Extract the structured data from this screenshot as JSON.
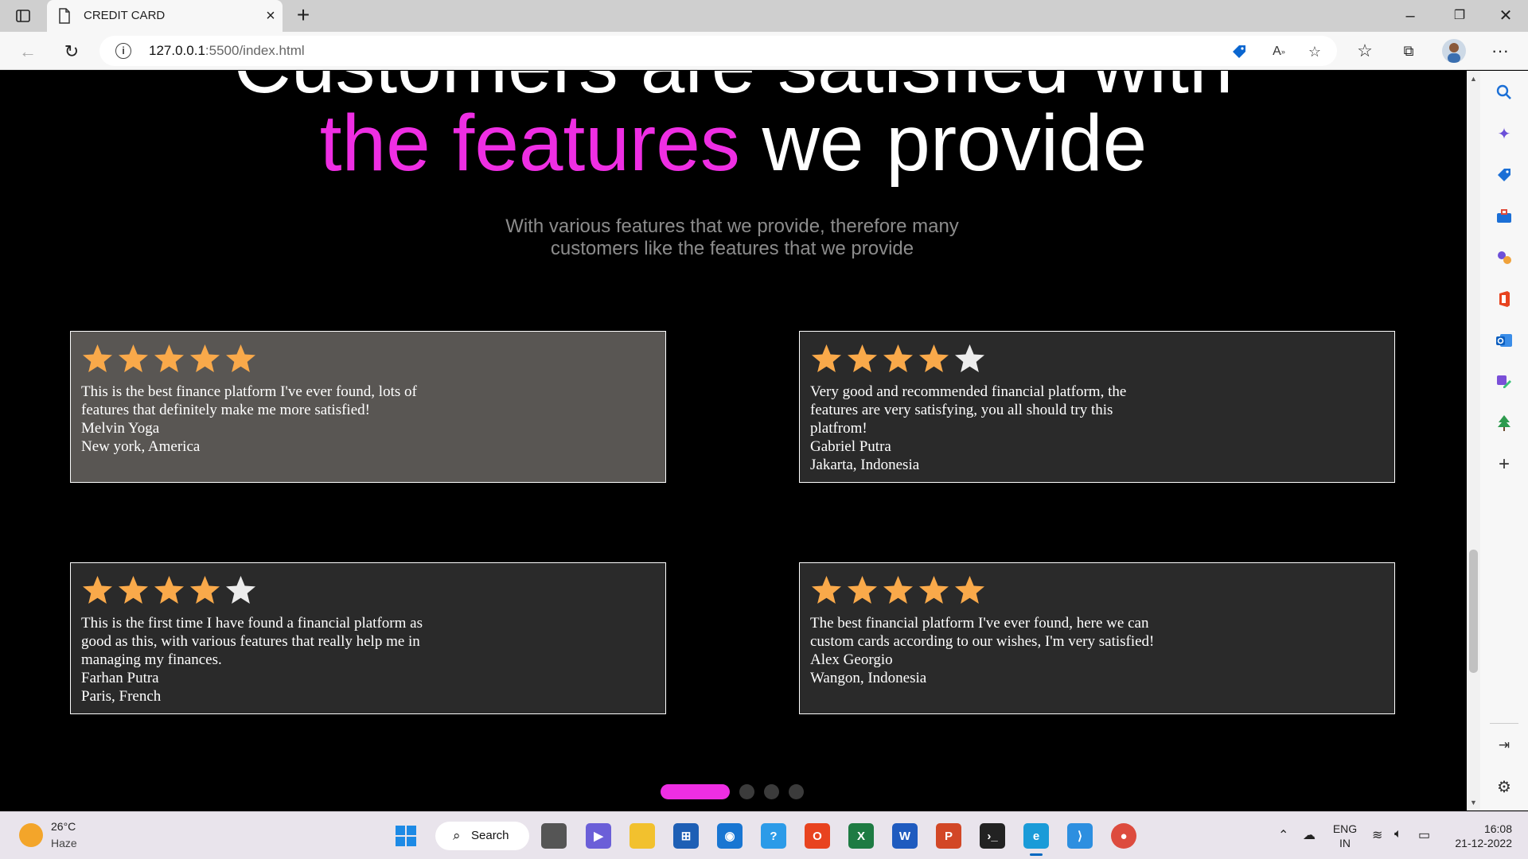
{
  "browser": {
    "tab_title": "CREDIT CARD",
    "url_host": "127.0.0.1",
    "url_rest": ":5500/index.html"
  },
  "page": {
    "headline_top": "Customers are satisfied with",
    "headline_pink": "the features",
    "headline_white": " we provide",
    "subtitle": "With various features that we provide, therefore many customers like the features that we provide",
    "star_colors": {
      "filled": "#f9a94a",
      "empty": "#ececec"
    },
    "accent_color": "#ee2ee3",
    "testimonials": [
      {
        "rating": 5,
        "text": "This is the best finance platform I've ever found, lots of features that definitely make me more satisfied!",
        "name": "Melvin Yoga",
        "location": "New york, America"
      },
      {
        "rating": 4,
        "text": "Very good and recommended financial platform, the features are very satisfying, you all should try this platfrom!",
        "name": "Gabriel Putra",
        "location": "Jakarta, Indonesia"
      },
      {
        "rating": 4,
        "text": "This is the first time I have found a financial platform as good as this, with various features that really help me in managing my finances.",
        "name": "Farhan Putra",
        "location": "Paris, French"
      },
      {
        "rating": 5,
        "text": "The best financial platform I've ever found, here we can custom cards according to our wishes, I'm very satisfied!",
        "name": "Alex Georgio",
        "location": "Wangon, Indonesia"
      }
    ],
    "pagination": {
      "count": 4,
      "active": 1
    }
  },
  "taskbar": {
    "weather_temp": "26°C",
    "weather_desc": "Haze",
    "search_label": "Search",
    "lang_1": "ENG",
    "lang_2": "IN",
    "time": "16:08",
    "date": "21-12-2022"
  }
}
